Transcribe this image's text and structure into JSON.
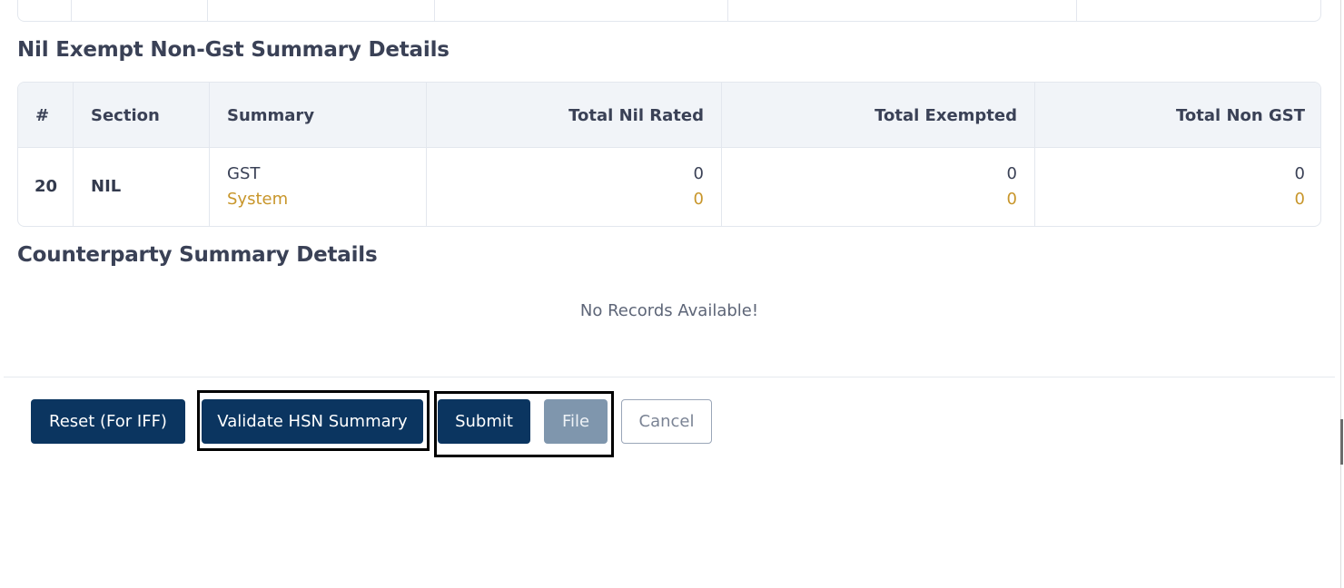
{
  "nil_section": {
    "title": "Nil Exempt Non-Gst Summary Details",
    "headers": {
      "num": "#",
      "section": "Section",
      "summary": "Summary",
      "total_nil_rated": "Total Nil Rated",
      "total_exempted": "Total Exempted",
      "total_non_gst": "Total Non GST"
    },
    "row": {
      "num": "20",
      "section": "NIL",
      "summary_primary": "GST",
      "summary_secondary": "System",
      "nil_rated_gst": "0",
      "nil_rated_system": "0",
      "exempted_gst": "0",
      "exempted_system": "0",
      "non_gst_gst": "0",
      "non_gst_system": "0"
    }
  },
  "counterparty_section": {
    "title": "Counterparty Summary Details",
    "empty_message": "No Records Available!"
  },
  "actions": {
    "reset_label": "Reset (For IFF)",
    "validate_label": "Validate HSN Summary",
    "submit_label": "Submit",
    "file_label": "File",
    "cancel_label": "Cancel"
  },
  "colors": {
    "primary_button": "#0b3560",
    "disabled_button": "#7f96ad",
    "system_value": "#c8962b",
    "header_bg": "#f1f4f8"
  }
}
